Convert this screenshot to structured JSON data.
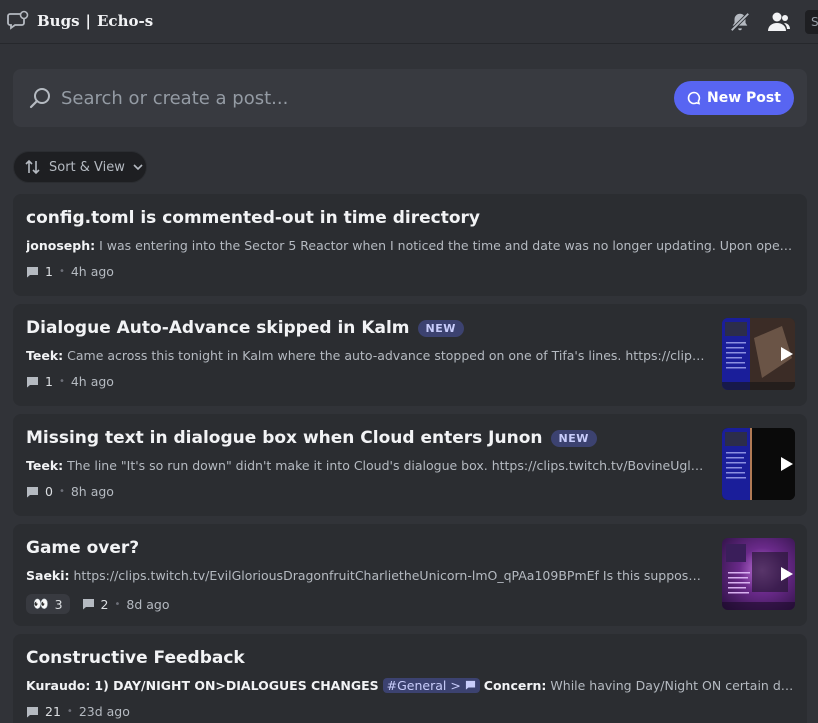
{
  "header": {
    "icon": "forum-icon",
    "title": "Bugs",
    "separator": "|",
    "channel": "Echo-s",
    "right_icons": [
      "mute-notifications-icon",
      "members-icon"
    ],
    "search_stub": "S"
  },
  "search": {
    "placeholder": "Search or create a post...",
    "value": "",
    "new_post_label": "New Post"
  },
  "sort": {
    "label": "Sort & View"
  },
  "posts": [
    {
      "title": "config.toml is commented-out in time directory",
      "badge": "",
      "author": "jonoseph:",
      "preview": "I was entering into the Sector 5 Reactor when I noticed the time and date was no longer updating. Upon opening con...",
      "message_count": "1",
      "time": "4h ago",
      "has_thumb": false
    },
    {
      "title": "Dialogue Auto-Advance skipped in Kalm",
      "badge": "NEW",
      "author": "Teek:",
      "preview": "Came across this tonight in Kalm where the auto-advance stopped on one of Tifa's lines. https://clips.twit...",
      "message_count": "1",
      "time": "4h ago",
      "has_thumb": true
    },
    {
      "title": "Missing text in dialogue box when Cloud enters Junon",
      "badge": "NEW",
      "author": "Teek:",
      "preview": "The line \"It's so run down\" didn't make it into Cloud's dialogue box. https://clips.twitch.tv/BovineUglyPorc...",
      "message_count": "0",
      "time": "8h ago",
      "has_thumb": true
    },
    {
      "title": "Game over?",
      "badge": "",
      "author": "Saeki:",
      "preview": "https://clips.twitch.tv/EvilGloriousDragonfruitCharlietheUnicorn-lmO_qPAa109BPmEf Is this supposed t...",
      "reaction_emoji": "👀",
      "reaction_count": "3",
      "message_count": "2",
      "time": "8d ago",
      "has_thumb": true
    },
    {
      "title": "Constructive Feedback",
      "badge": "",
      "author": "Kuraudo:",
      "preview_start": "1) DAY/NIGHT ON>DIALOGUES CHANGES",
      "channel_tag": "#General",
      "tag_arrow": ">",
      "concern_label": "Concern:",
      "preview": "While having Day/Night ON certain dialogues ...",
      "message_count": "21",
      "time": "23d ago",
      "has_thumb": false
    }
  ],
  "colors": {
    "background": "#313338",
    "card": "#2b2d31",
    "accent": "#5865f2",
    "badge_bg": "#3c4270"
  }
}
